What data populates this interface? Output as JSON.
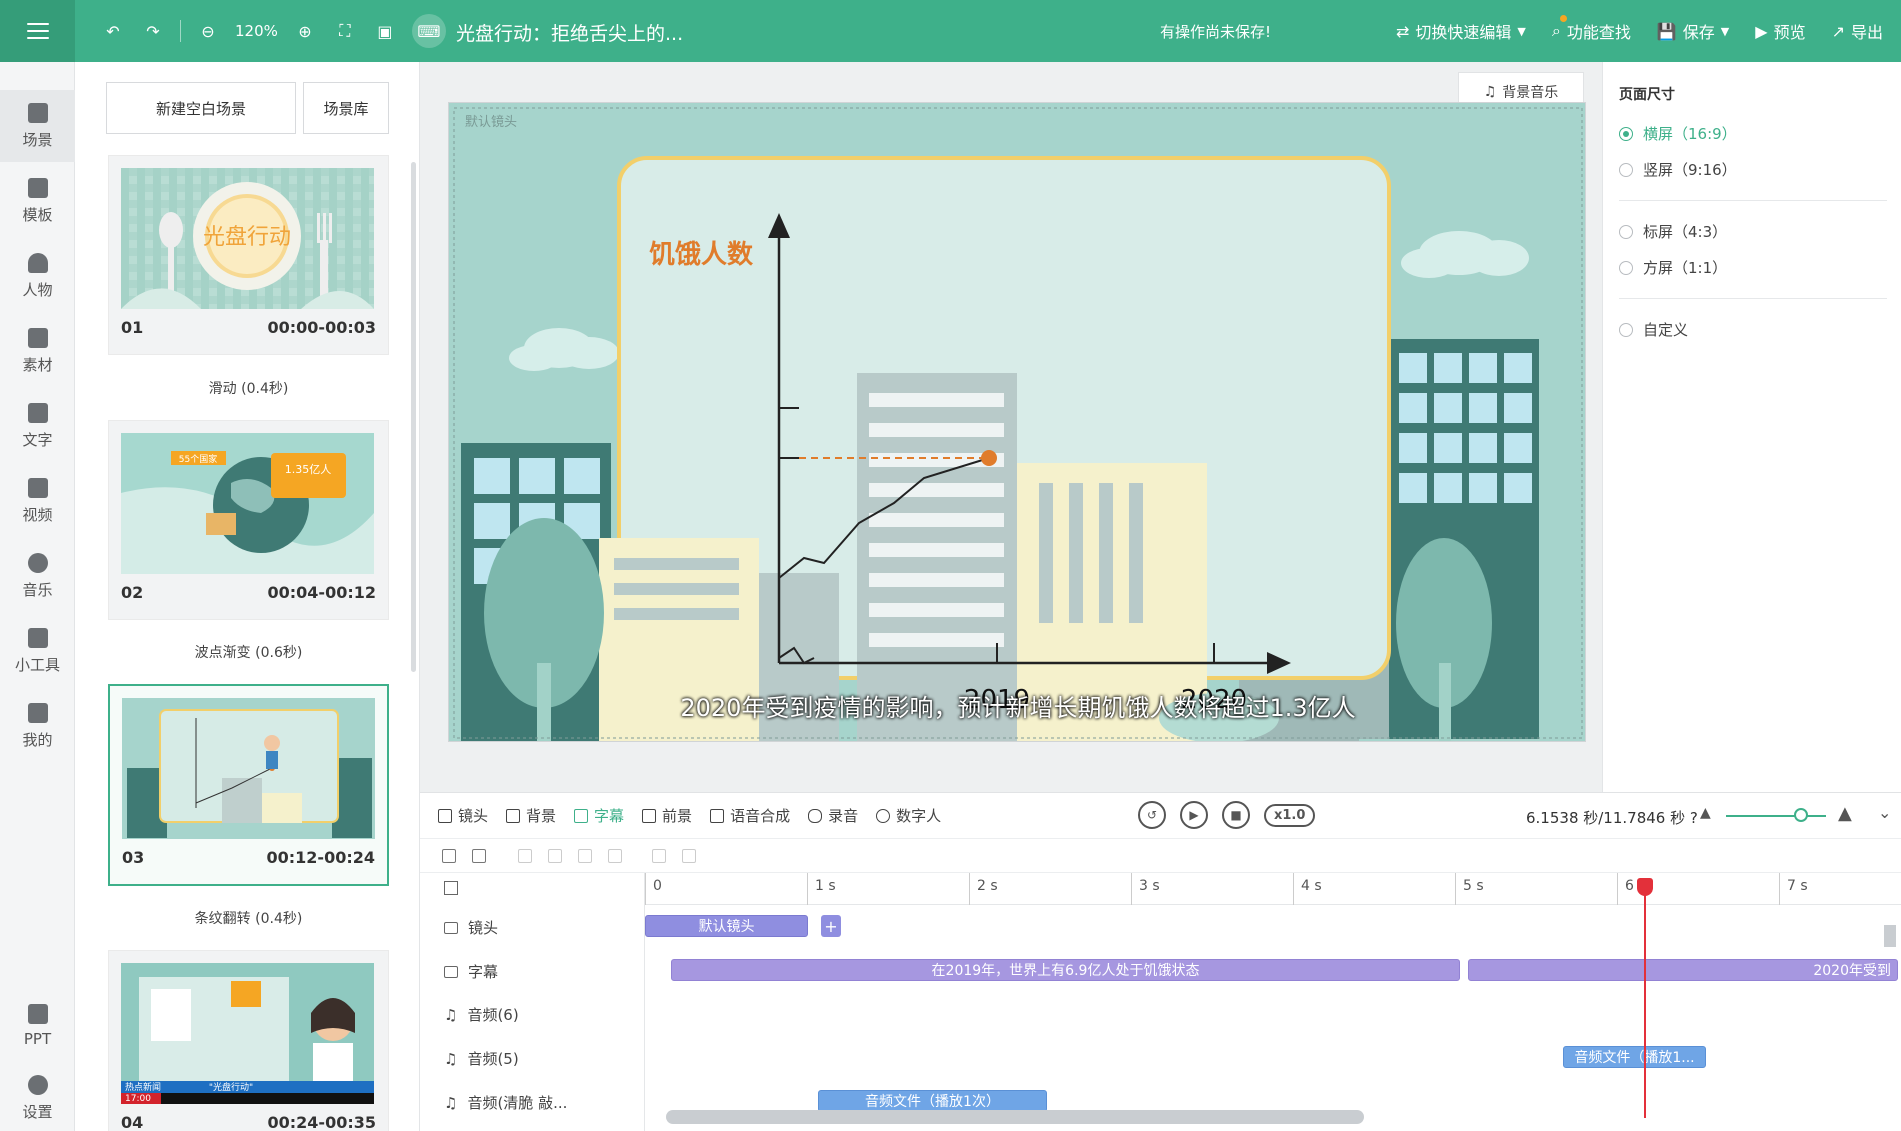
{
  "topbar": {
    "zoom": "120%",
    "title": "光盘行动：拒绝舌尖上的...",
    "unsaved_notice": "有操作尚未保存!",
    "quick_edit": "切换快速编辑",
    "feature_search": "功能查找",
    "save": "保存",
    "preview": "预览",
    "export": "导出"
  },
  "rail": {
    "items": [
      "场景",
      "模板",
      "人物",
      "素材",
      "文字",
      "视频",
      "音乐",
      "小工具",
      "我的"
    ],
    "bottom": [
      "PPT",
      "设置"
    ]
  },
  "scenes_panel": {
    "new_blank": "新建空白场景",
    "library": "场景库",
    "scenes": [
      {
        "index": "01",
        "time": "00:00-00:03",
        "transition": "滑动 (0.4秒)"
      },
      {
        "index": "02",
        "time": "00:04-00:12",
        "transition": "波点渐变 (0.6秒)"
      },
      {
        "index": "03",
        "time": "00:12-00:24",
        "transition": "条纹翻转 (0.4秒)"
      },
      {
        "index": "04",
        "time": "00:24-00:35"
      }
    ],
    "thumb1_text": "光盘行动",
    "thumb2_tag1": "55个国家",
    "thumb2_tag2": "1.35亿人",
    "thumb4_line1": "热点新闻",
    "thumb4_line2": "\"光盘行动\"",
    "thumb4_time": "17:00"
  },
  "canvas": {
    "bgm_button": "背景音乐",
    "default_lens": "默认镜头",
    "chart_title": "饥饿人数",
    "x_labels": [
      "2019",
      "2020"
    ],
    "subtitle": "2020年受到疫情的影响，预计新增长期饥饿人数将超过1.3亿人"
  },
  "props": {
    "heading": "页面尺寸",
    "options": [
      {
        "label": "横屏（16:9）",
        "selected": true
      },
      {
        "label": "竖屏（9:16）",
        "selected": false
      },
      {
        "label": "标屏（4:3）",
        "selected": false
      },
      {
        "label": "方屏（1:1）",
        "selected": false
      },
      {
        "label": "自定义",
        "selected": false
      }
    ]
  },
  "timeline": {
    "tabs": [
      "镜头",
      "背景",
      "字幕",
      "前景",
      "语音合成",
      "录音",
      "数字人"
    ],
    "active_tab": "字幕",
    "speed": "x1.0",
    "time_readout": "6.1538 秒/11.7846 秒",
    "ruler": [
      "0",
      "1 s",
      "2 s",
      "3 s",
      "4 s",
      "5 s",
      "6",
      "7 s"
    ],
    "tracks": [
      "镜头",
      "字幕",
      "音频(6)",
      "音频(5)",
      "音频(清脆 敲..."
    ],
    "clips": {
      "lens": "默认镜头",
      "sub1": "在2019年，世界上有6.9亿人处于饥饿状态",
      "sub2": "2020年受到",
      "audio5": "音频文件（播放1...",
      "audio_click": "音频文件（播放1次）"
    }
  },
  "colors": {
    "brand": "#3eb08a",
    "playhead": "#e3303a",
    "lens_clip": "#8f8ee0",
    "subtitle_clip": "#a697e0",
    "audio_clip": "#6fa5e6"
  }
}
